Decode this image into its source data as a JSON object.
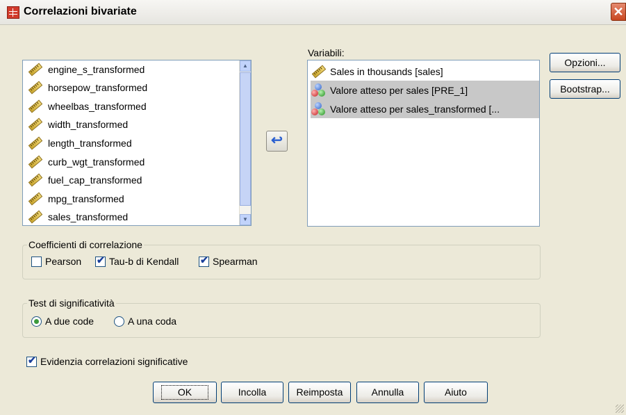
{
  "window": {
    "title": "Correlazioni bivariate",
    "icon": "table-icon",
    "close_label": "✕"
  },
  "source_list": {
    "items": [
      {
        "label": "engine_s_transformed",
        "icon": "ruler-icon"
      },
      {
        "label": "horsepow_transformed",
        "icon": "ruler-icon"
      },
      {
        "label": "wheelbas_transformed",
        "icon": "ruler-icon"
      },
      {
        "label": "width_transformed",
        "icon": "ruler-icon"
      },
      {
        "label": "length_transformed",
        "icon": "ruler-icon"
      },
      {
        "label": "curb_wgt_transformed",
        "icon": "ruler-icon"
      },
      {
        "label": "fuel_cap_transformed",
        "icon": "ruler-icon"
      },
      {
        "label": "mpg_transformed",
        "icon": "ruler-icon"
      },
      {
        "label": "sales_transformed",
        "icon": "ruler-icon"
      }
    ]
  },
  "move_button": {
    "icon": "arrow-left-icon",
    "glyph": "↩"
  },
  "variables": {
    "label": "Variabili:",
    "items": [
      {
        "label": "Sales in thousands [sales]",
        "icon": "ruler-icon",
        "selected": false
      },
      {
        "label": "Valore atteso per sales [PRE_1]",
        "icon": "nominal-balls-icon",
        "selected": true
      },
      {
        "label": "Valore atteso per sales_transformed [...",
        "icon": "nominal-balls-icon",
        "selected": true
      }
    ]
  },
  "side_buttons": {
    "options": "Opzioni...",
    "bootstrap": "Bootstrap..."
  },
  "correlation": {
    "legend": "Coefficienti di correlazione",
    "pearson": {
      "label": "Pearson",
      "checked": false
    },
    "kendall": {
      "label": "Tau-b di Kendall",
      "checked": true
    },
    "spearman": {
      "label": "Spearman",
      "checked": true
    }
  },
  "significance": {
    "legend": "Test di significatività",
    "two_tailed": {
      "label": "A due code",
      "selected": true
    },
    "one_tailed": {
      "label": "A una coda",
      "selected": false
    }
  },
  "flag": {
    "label": "Evidenzia correlazioni significative",
    "checked": true
  },
  "bottom_buttons": {
    "ok": "OK",
    "paste": "Incolla",
    "reset": "Reimposta",
    "cancel": "Annulla",
    "help": "Aiuto"
  },
  "colors": {
    "dialog_bg": "#ece9d8",
    "selection": "#c8c8c8",
    "close_red": "#c8461f",
    "check_blue": "#1a3f9a",
    "radio_green": "#3c9a3c"
  }
}
